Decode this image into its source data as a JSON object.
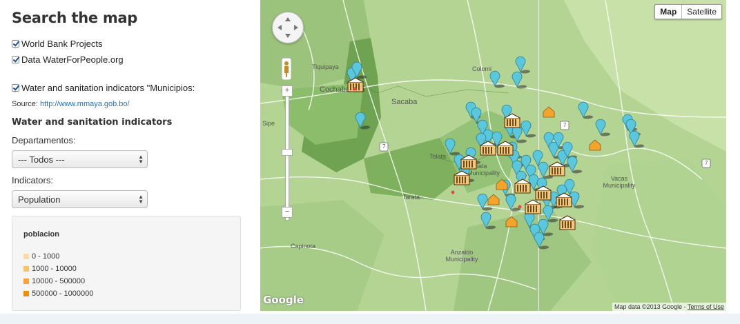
{
  "sidebar": {
    "title": "Search the map",
    "layers": [
      {
        "label": "World Bank Projects",
        "checked": true
      },
      {
        "label": "Data WaterForPeople.org",
        "checked": true
      },
      {
        "label": "Water and sanitation indicators \"Municipios:",
        "checked": true
      }
    ],
    "source_label": "Source:",
    "source_link": "http://www.mmaya.gob.bo/",
    "section_heading": "Water and sanitation indicators",
    "departamentos_label": "Departamentos:",
    "departamentos_value": "--- Todos ---",
    "indicators_label": "Indicators:",
    "indicators_value": "Population",
    "legend": {
      "title": "poblacion",
      "items": [
        {
          "label": "0 - 1000",
          "color": "#fcd9a8"
        },
        {
          "label": "1000 - 10000",
          "color": "#fbbf6f"
        },
        {
          "label": "10000 - 500000",
          "color": "#f7a33b"
        },
        {
          "label": "500000 - 1000000",
          "color": "#f28c0f"
        }
      ]
    }
  },
  "map": {
    "type_buttons": {
      "map": "Map",
      "satellite": "Satellite",
      "active": "Map"
    },
    "place_labels": [
      "Tiquipaya",
      "Colomi",
      "Sacaba",
      "Cochabamba",
      "Sipe",
      "Vacas Municipality",
      "Tarata",
      "Capinota",
      "Anzaldo Municipality",
      "Tolata",
      "Punata Municipality"
    ],
    "road_numbers": [
      "7",
      "7",
      "7"
    ],
    "attribution": "Map data ©2013 Google -",
    "terms": "Terms of Use",
    "logo": "Google",
    "zoom_in": "+",
    "zoom_out": "−",
    "colors": {
      "marker": "#5bc7dd",
      "marker_shadow": "#2d2d2d",
      "house": "#f2a52a",
      "project": "#b96e1a"
    }
  }
}
